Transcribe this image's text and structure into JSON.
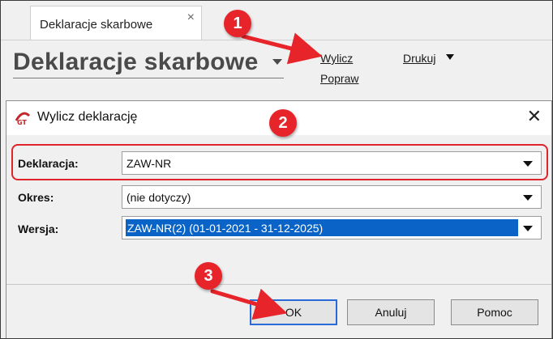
{
  "tab": {
    "label": "Deklaracje skarbowe",
    "close_glyph": "×"
  },
  "page": {
    "title": "Deklaracje skarbowe",
    "links": {
      "wylicz": "Wylicz",
      "popraw": "Popraw",
      "drukuj": "Drukuj"
    }
  },
  "dialog": {
    "title": "Wylicz deklarację",
    "close_glyph": "✕",
    "fields": [
      {
        "label": "Deklaracja:",
        "value": "ZAW-NR"
      },
      {
        "label": "Okres:",
        "value": "(nie dotyczy)"
      },
      {
        "label": "Wersja:",
        "value": "ZAW-NR(2) (01-01-2021 - 31-12-2025)"
      }
    ],
    "buttons": {
      "ok": "OK",
      "cancel": "Anuluj",
      "help": "Pomoc"
    }
  },
  "annotations": [
    {
      "number": "1"
    },
    {
      "number": "2"
    },
    {
      "number": "3"
    }
  ],
  "colors": {
    "marker": "#e8242b",
    "selection": "#0a64c8",
    "highlight_border": "#e0242c"
  }
}
